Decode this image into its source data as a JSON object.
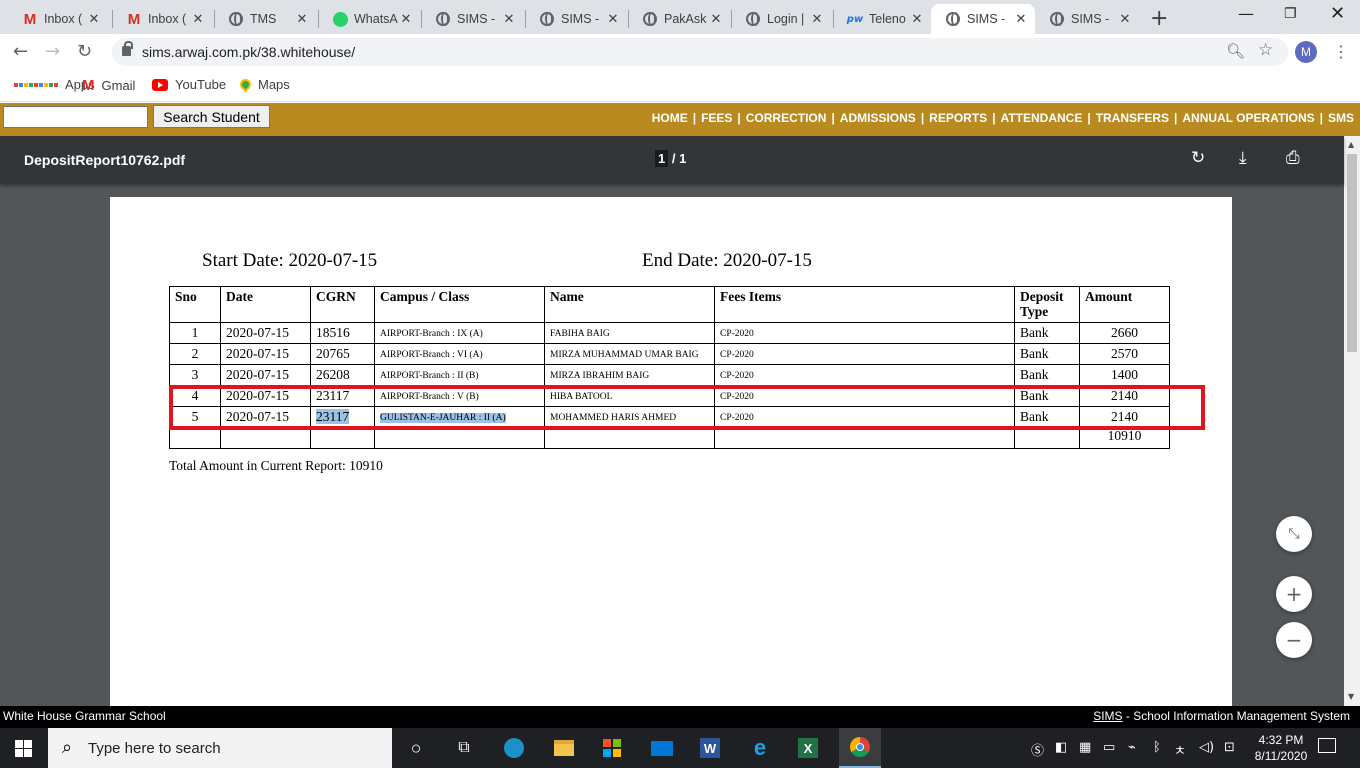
{
  "browser": {
    "tabs": [
      {
        "title": "Inbox (",
        "icon": "gmail-icon"
      },
      {
        "title": "Inbox (",
        "icon": "gmail-icon"
      },
      {
        "title": "TMS",
        "icon": "globe-icon"
      },
      {
        "title": "WhatsA",
        "icon": "whatsapp-icon"
      },
      {
        "title": "SIMS -",
        "icon": "globe-icon"
      },
      {
        "title": "SIMS -",
        "icon": "globe-icon"
      },
      {
        "title": "PakAsk",
        "icon": "globe-icon"
      },
      {
        "title": "Login |",
        "icon": "globe-icon"
      },
      {
        "title": "Teleno",
        "icon": "telenor-icon"
      },
      {
        "title": "SIMS -",
        "icon": "globe-icon",
        "active": true
      },
      {
        "title": "SIMS -",
        "icon": "globe-icon"
      }
    ],
    "url": "sims.arwaj.com.pk/38.whitehouse/",
    "profile_initial": "M",
    "bookmarks": [
      {
        "label": "Apps",
        "icon": "apps-grid-icon"
      },
      {
        "label": "Gmail",
        "icon": "gmail-icon"
      },
      {
        "label": "YouTube",
        "icon": "youtube-icon"
      },
      {
        "label": "Maps",
        "icon": "maps-icon"
      }
    ]
  },
  "site": {
    "search_button": "Search Student",
    "nav": [
      "HOME",
      "FEES",
      "CORRECTION",
      "ADMISSIONS",
      "REPORTS",
      "ATTENDANCE",
      "TRANSFERS",
      "ANNUAL OPERATIONS",
      "SMS"
    ],
    "bar_color": "#b88a20",
    "footer_left": "White House Grammar School",
    "footer_link": "SIMS",
    "footer_right": " - School Information Management System"
  },
  "pdf": {
    "filename": "DepositReport10762.pdf",
    "page_current": "1",
    "page_total": "/ 1",
    "start_date": "Start Date: 2020-07-15",
    "end_date": "End Date: 2020-07-15",
    "headers": [
      "Sno",
      "Date",
      "CGRN",
      "Campus / Class",
      "Name",
      "Fees Items",
      "Deposit Type",
      "Amount"
    ],
    "rows": [
      {
        "sno": "1",
        "date": "2020-07-15",
        "cgrn": "18516",
        "campus": "AIRPORT-Branch : IX (A)",
        "name": "FABIHA BAIG",
        "fees": "CP-2020",
        "type": "Bank",
        "amount": "2660"
      },
      {
        "sno": "2",
        "date": "2020-07-15",
        "cgrn": "20765",
        "campus": "AIRPORT-Branch : VI (A)",
        "name": "MIRZA MUHAMMAD UMAR BAIG",
        "fees": "CP-2020",
        "type": "Bank",
        "amount": "2570"
      },
      {
        "sno": "3",
        "date": "2020-07-15",
        "cgrn": "26208",
        "campus": "AIRPORT-Branch : II (B)",
        "name": "MIRZA IBRAHIM BAIG",
        "fees": "CP-2020",
        "type": "Bank",
        "amount": "1400"
      },
      {
        "sno": "4",
        "date": "2020-07-15",
        "cgrn": "23117",
        "campus": "AIRPORT-Branch : V (B)",
        "name": "HIBA BATOOL",
        "fees": "CP-2020",
        "type": "Bank",
        "amount": "2140"
      },
      {
        "sno": "5",
        "date": "2020-07-15",
        "cgrn": "23117",
        "campus": "GULISTAN-E-JAUHAR : II (A)",
        "name": "MOHAMMED HARIS AHMED",
        "fees": "CP-2020",
        "type": "Bank",
        "amount": "2140"
      }
    ],
    "sum_total": "10910",
    "total_text": "Total Amount in Current Report: 10910",
    "highlight_color": "#e0141e"
  },
  "taskbar": {
    "search_placeholder": "Type here to search",
    "time": "4:32 PM",
    "date": "8/11/2020",
    "apps": [
      "task-view-icon",
      "edge-icon",
      "file-explorer-icon",
      "store-icon",
      "mail-icon",
      "word-icon",
      "ie-icon",
      "excel-icon",
      "chrome-icon"
    ]
  }
}
